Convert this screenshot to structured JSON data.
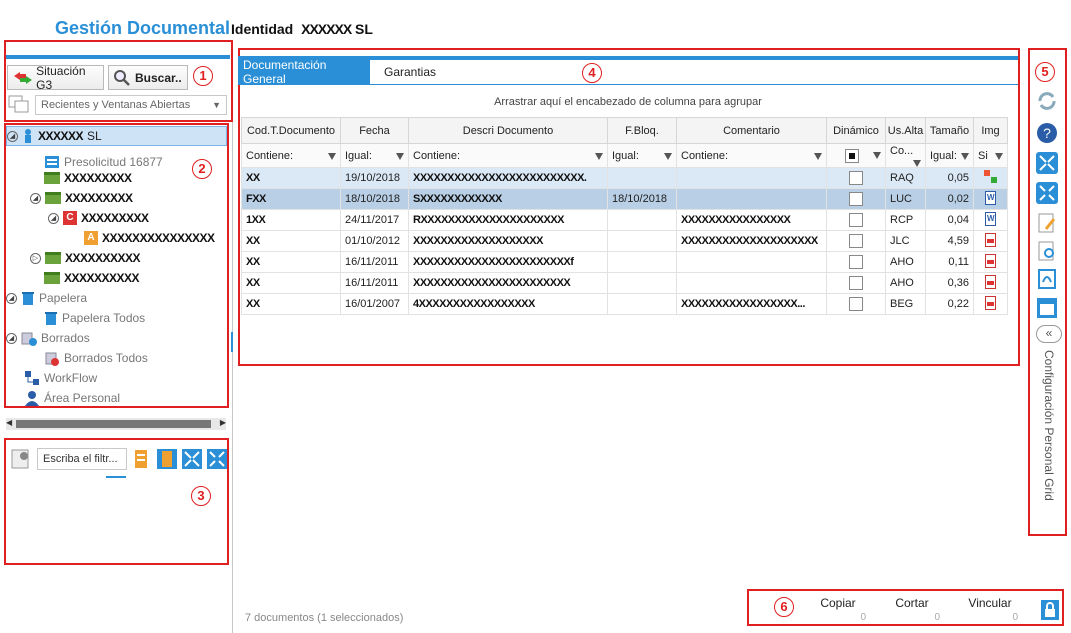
{
  "header": {
    "app_title": "Gestión Documental",
    "identity_label": "Identidad",
    "identity_value": "XXXXXX",
    "identity_suffix": "SL"
  },
  "sidebar": {
    "situacion_label": "Situación G3",
    "buscar_label": "Buscar..",
    "recientes_label": "Recientes y Ventanas Abiertas",
    "tree": [
      {
        "label": "XXXXXX",
        "suffix": "SL"
      },
      {
        "label": "Presolicitud 16877"
      },
      {
        "label": "XXXXXXXXX"
      },
      {
        "label": "XXXXXXXXX"
      },
      {
        "label": "XXXXXXXXX"
      },
      {
        "label": "XXXXXXXXXXXXXXX"
      },
      {
        "label": "XXXXXXXXXX"
      },
      {
        "label": "XXXXXXXXXX"
      },
      {
        "label": "Papelera"
      },
      {
        "label": "Papelera Todos"
      },
      {
        "label": "Borrados"
      },
      {
        "label": "Borrados Todos"
      },
      {
        "label": "WorkFlow"
      },
      {
        "label": "Área Personal"
      }
    ],
    "filter_placeholder": "Escriba el filtr..."
  },
  "tabs": [
    {
      "label": "Documentación General"
    },
    {
      "label": "Garantias"
    }
  ],
  "grid": {
    "group_hint": "Arrastrar aquí el encabezado de columna para agrupar",
    "columns": [
      "Cod.T.Documento",
      "Fecha",
      "Descri Documento",
      "F.Bloq.",
      "Comentario",
      "Dinámico",
      "Us.Alta",
      "Tamaño",
      "Img"
    ],
    "filters": [
      "Contiene:",
      "Igual:",
      "Contiene:",
      "Igual:",
      "Contiene:",
      "",
      "Co...",
      "Igual:",
      "Si"
    ],
    "rows": [
      {
        "cod": "XX",
        "fecha": "19/10/2018",
        "descri": "XXXXXXXXXXXXXXXXXXXXXXXXX.",
        "fbloq": "",
        "coment": "",
        "us": "RAQ",
        "tam": "0,05",
        "img": "multi"
      },
      {
        "cod": "FXX",
        "fecha": "18/10/2018",
        "descri": "SXXXXXXXXXXXX",
        "fbloq": "18/10/2018",
        "coment": "",
        "us": "LUC",
        "tam": "0,02",
        "img": "word"
      },
      {
        "cod": "1XX",
        "fecha": "24/11/2017",
        "descri": "RXXXXXXXXXXXXXXXXXXXXX",
        "fbloq": "",
        "coment": "XXXXXXXXXXXXXXXX",
        "us": "RCP",
        "tam": "0,04",
        "img": "word"
      },
      {
        "cod": "XX",
        "fecha": "01/10/2012",
        "descri": "XXXXXXXXXXXXXXXXXXX",
        "fbloq": "",
        "coment": "XXXXXXXXXXXXXXXXXXXX",
        "us": "JLC",
        "tam": "4,59",
        "img": "pdf"
      },
      {
        "cod": "XX",
        "fecha": "16/11/2011",
        "descri": "XXXXXXXXXXXXXXXXXXXXXXXf",
        "fbloq": "",
        "coment": "",
        "us": "AHO",
        "tam": "0,11",
        "img": "pdf"
      },
      {
        "cod": "XX",
        "fecha": "16/11/2011",
        "descri": "XXXXXXXXXXXXXXXXXXXXXXX",
        "fbloq": "",
        "coment": "",
        "us": "AHO",
        "tam": "0,36",
        "img": "pdf"
      },
      {
        "cod": "XX",
        "fecha": "16/01/2007",
        "descri": "4XXXXXXXXXXXXXXXXX",
        "fbloq": "",
        "coment": "XXXXXXXXXXXXXXXXX...",
        "us": "BEG",
        "tam": "0,22",
        "img": "pdf"
      }
    ]
  },
  "status_text": "7 documentos (1 seleccionados)",
  "bottom": {
    "copiar": "Copiar",
    "copiar_val": "0",
    "cortar": "Cortar",
    "cortar_val": "0",
    "vincular": "Vincular",
    "vincular_val": "0"
  },
  "right_panel_label": "Configuración Personal Grid",
  "badges": [
    "1",
    "2",
    "3",
    "4",
    "5",
    "6"
  ]
}
